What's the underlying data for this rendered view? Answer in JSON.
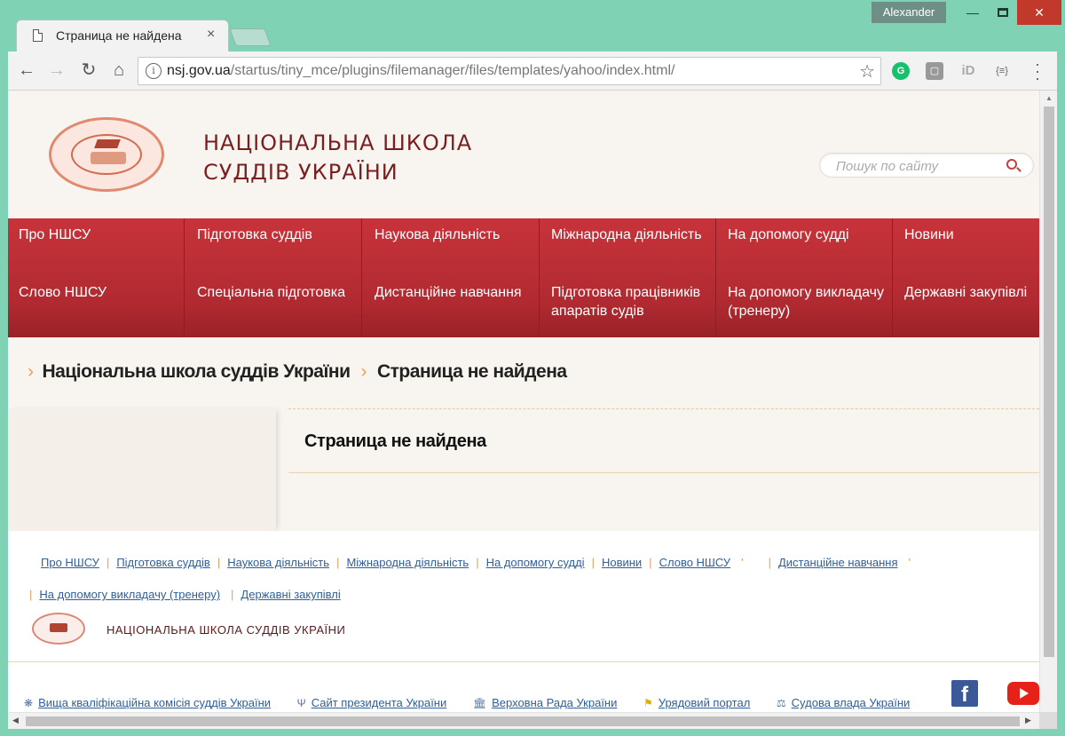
{
  "window": {
    "user": "Alexander",
    "tab_title": "Страница не найдена",
    "url_host": "nsj.gov.ua",
    "url_path": "/startus/tiny_mce/plugins/filemanager/files/templates/yahoo/index.html/"
  },
  "header": {
    "title_line1": "НАЦІОНАЛЬНА ШКОЛА",
    "title_line2": "СУДДІВ УКРАЇНИ",
    "search_placeholder": "Пошук по сайту"
  },
  "menu": {
    "columns": [
      {
        "top": "Про НШСУ",
        "bottom": "Слово НШСУ"
      },
      {
        "top": "Підготовка суддів",
        "bottom": "Спеціальна підготовка"
      },
      {
        "top": "Наукова діяльність",
        "bottom": "Дистанційне навчання"
      },
      {
        "top": "Міжнародна діяльність",
        "bottom": "Підготовка працівників апаратів судів"
      },
      {
        "top": "На допомогу судді",
        "bottom": "На допомогу викладачу (тренеру)"
      },
      {
        "top": "Новини",
        "bottom": "Державні закупівлі"
      }
    ]
  },
  "breadcrumb": {
    "home": "Національна школа суддів України",
    "current": "Страница не найдена"
  },
  "content": {
    "heading": "Страница не найдена"
  },
  "footer": {
    "links_row1": [
      "Про НШСУ",
      "Підготовка суддів",
      "Наукова діяльність",
      "Міжнародна діяльність",
      "На допомогу судді",
      "Новини",
      "Слово НШСУ",
      "Дистанційне навчання"
    ],
    "links_row2": [
      "На допомогу викладачу (тренеру)",
      "Державні закупівлі"
    ],
    "org_name": "НАЦІОНАЛЬНА ШКОЛА СУДДІВ УКРАЇНИ",
    "partners": [
      {
        "icon": "gear-icon",
        "label": "Вища кваліфікаційна комісія суддів України"
      },
      {
        "icon": "trident-icon",
        "label": "Сайт президента України"
      },
      {
        "icon": "parliament-icon",
        "label": "Верховна Рада України"
      },
      {
        "icon": "ua-flag-icon",
        "label": "Урядовий портал"
      },
      {
        "icon": "scales-icon",
        "label": "Судова влада України"
      }
    ]
  },
  "colors": {
    "menu_red": "#b12a31",
    "title_maroon": "#7a1f1f",
    "link_blue": "#2d5f9c",
    "chevron_orange": "#f0a050",
    "browser_frame": "#7fd3b4"
  }
}
